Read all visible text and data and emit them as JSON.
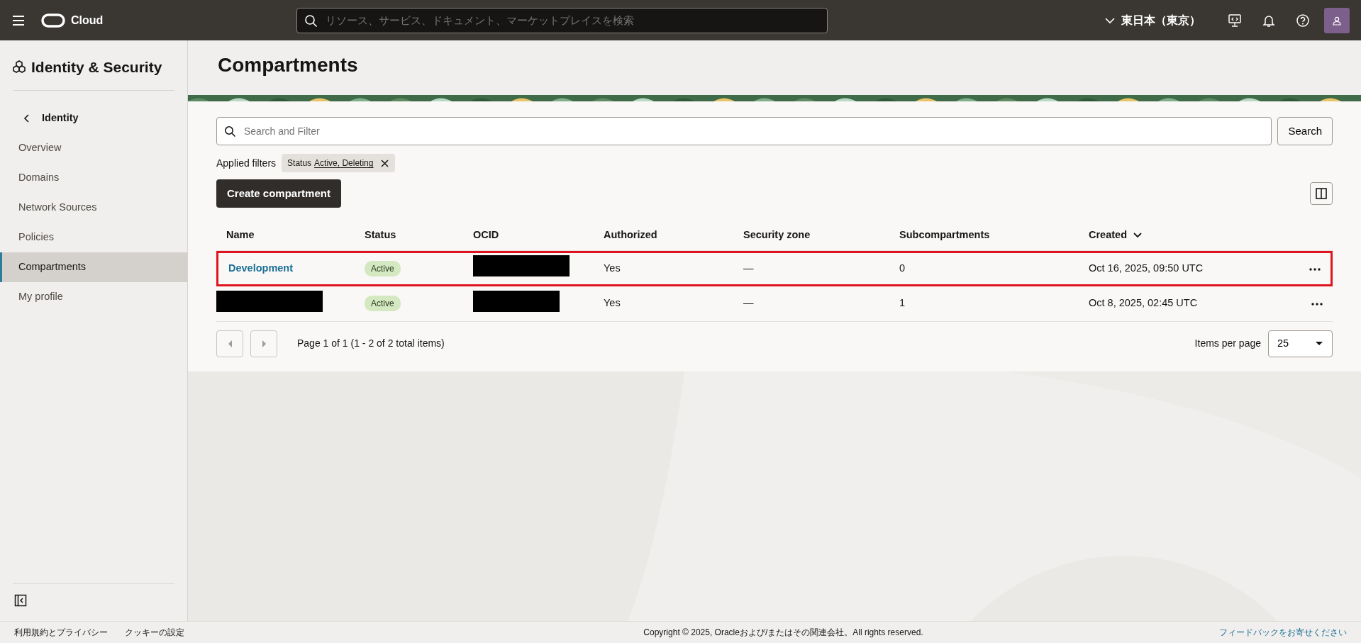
{
  "topbar": {
    "brand": "Cloud",
    "search_placeholder": "リソース、サービス、ドキュメント、マーケットプレイスを検索",
    "region": "東日本（東京）"
  },
  "sidebar": {
    "title": "Identity & Security",
    "back_label": "Identity",
    "items": [
      {
        "label": "Overview",
        "selected": false
      },
      {
        "label": "Domains",
        "selected": false
      },
      {
        "label": "Network Sources",
        "selected": false
      },
      {
        "label": "Policies",
        "selected": false
      },
      {
        "label": "Compartments",
        "selected": true
      },
      {
        "label": "My profile",
        "selected": false
      }
    ]
  },
  "page": {
    "title": "Compartments",
    "search": {
      "placeholder": "Search and Filter"
    },
    "search_button": "Search",
    "applied_filters_label": "Applied filters",
    "filter_chip": {
      "field": "Status",
      "value": "Active, Deleting"
    },
    "create_button": "Create compartment"
  },
  "table": {
    "columns": [
      {
        "label": "Name",
        "sorted": false
      },
      {
        "label": "Status",
        "sorted": false
      },
      {
        "label": "OCID",
        "sorted": false
      },
      {
        "label": "Authorized",
        "sorted": false
      },
      {
        "label": "Security zone",
        "sorted": false
      },
      {
        "label": "Subcompartments",
        "sorted": false
      },
      {
        "label": "Created",
        "sorted": true
      }
    ],
    "rows": [
      {
        "highlighted": true,
        "name": {
          "text": "Development",
          "redacted": false
        },
        "status": "Active",
        "ocid": {
          "redacted": true
        },
        "authorized": "Yes",
        "security_zone": "—",
        "subcompartments": "0",
        "created": "Oct 16, 2025, 09:50 UTC"
      },
      {
        "highlighted": false,
        "name": {
          "redacted": true
        },
        "status": "Active",
        "ocid": {
          "redacted": true
        },
        "authorized": "Yes",
        "security_zone": "—",
        "subcompartments": "1",
        "created": "Oct 8, 2025, 02:45 UTC"
      }
    ]
  },
  "pagination": {
    "prev_disabled": true,
    "next_disabled": true,
    "summary": "Page 1 of 1 (1 - 2 of 2 total items)",
    "per_page_label": "Items per page",
    "per_page_value": "25"
  },
  "footer": {
    "links": [
      "利用規約とプライバシー",
      "クッキーの設定"
    ],
    "copyright": "Copyright © 2025, Oracleおよび/またはその関連会社。All rights reserved.",
    "feedback": "フィードバックをお寄せください"
  }
}
